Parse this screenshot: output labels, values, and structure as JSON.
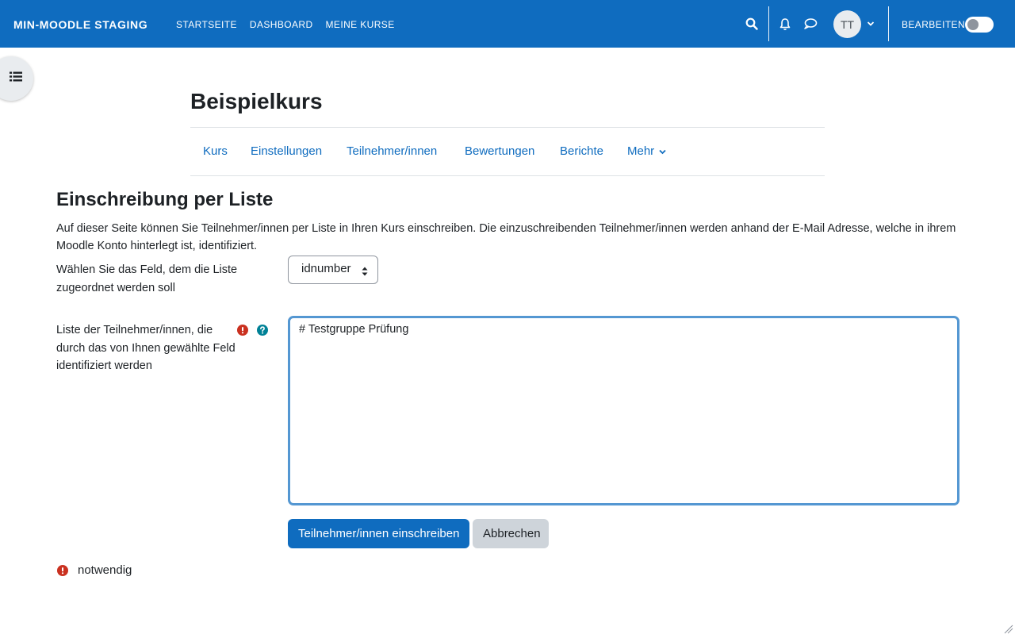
{
  "navbar": {
    "brand": "MIN-MOODLE STAGING",
    "links": [
      "STARTSEITE",
      "DASHBOARD",
      "MEINE KURSE"
    ],
    "avatar_initials": "TT",
    "edit_mode_label": "BEARBEITEN",
    "edit_mode_on": false,
    "icons": [
      "search-icon",
      "bell-icon",
      "chat-bubble-icon",
      "chevron-down-icon"
    ]
  },
  "course": {
    "title": "Beispielkurs",
    "tabs": [
      "Kurs",
      "Einstellungen",
      "Teilnehmer/innen",
      "Bewertungen",
      "Berichte",
      "Mehr"
    ]
  },
  "page": {
    "heading": "Einschreibung per Liste",
    "intro": "Auf dieser Seite können Sie Teilnehmer/innen per Liste in Ihren Kurs einschreiben. Die einzuschreibenden Teilnehmer/innen werden anhand der E-Mail Adresse, welche in ihrem Moodle Konto hinterlegt ist, identifiziert."
  },
  "form": {
    "field_label": "Wählen Sie das Feld, dem die Liste zugeordnet werden soll",
    "field_value": "idnumber",
    "list_label": "Liste der Teilnehmer/innen, die durch das von Ihnen gewählte Feld identifiziert werden",
    "list_value": "# Testgruppe Prüfung",
    "submit_label": "Teilnehmer/innen einschreiben",
    "cancel_label": "Abbrechen",
    "required_note": "notwendig"
  },
  "colors": {
    "brand_blue": "#0f6cbf",
    "required_red": "#ca3120",
    "help_teal": "#008196",
    "focus_border": "#5497d2"
  }
}
